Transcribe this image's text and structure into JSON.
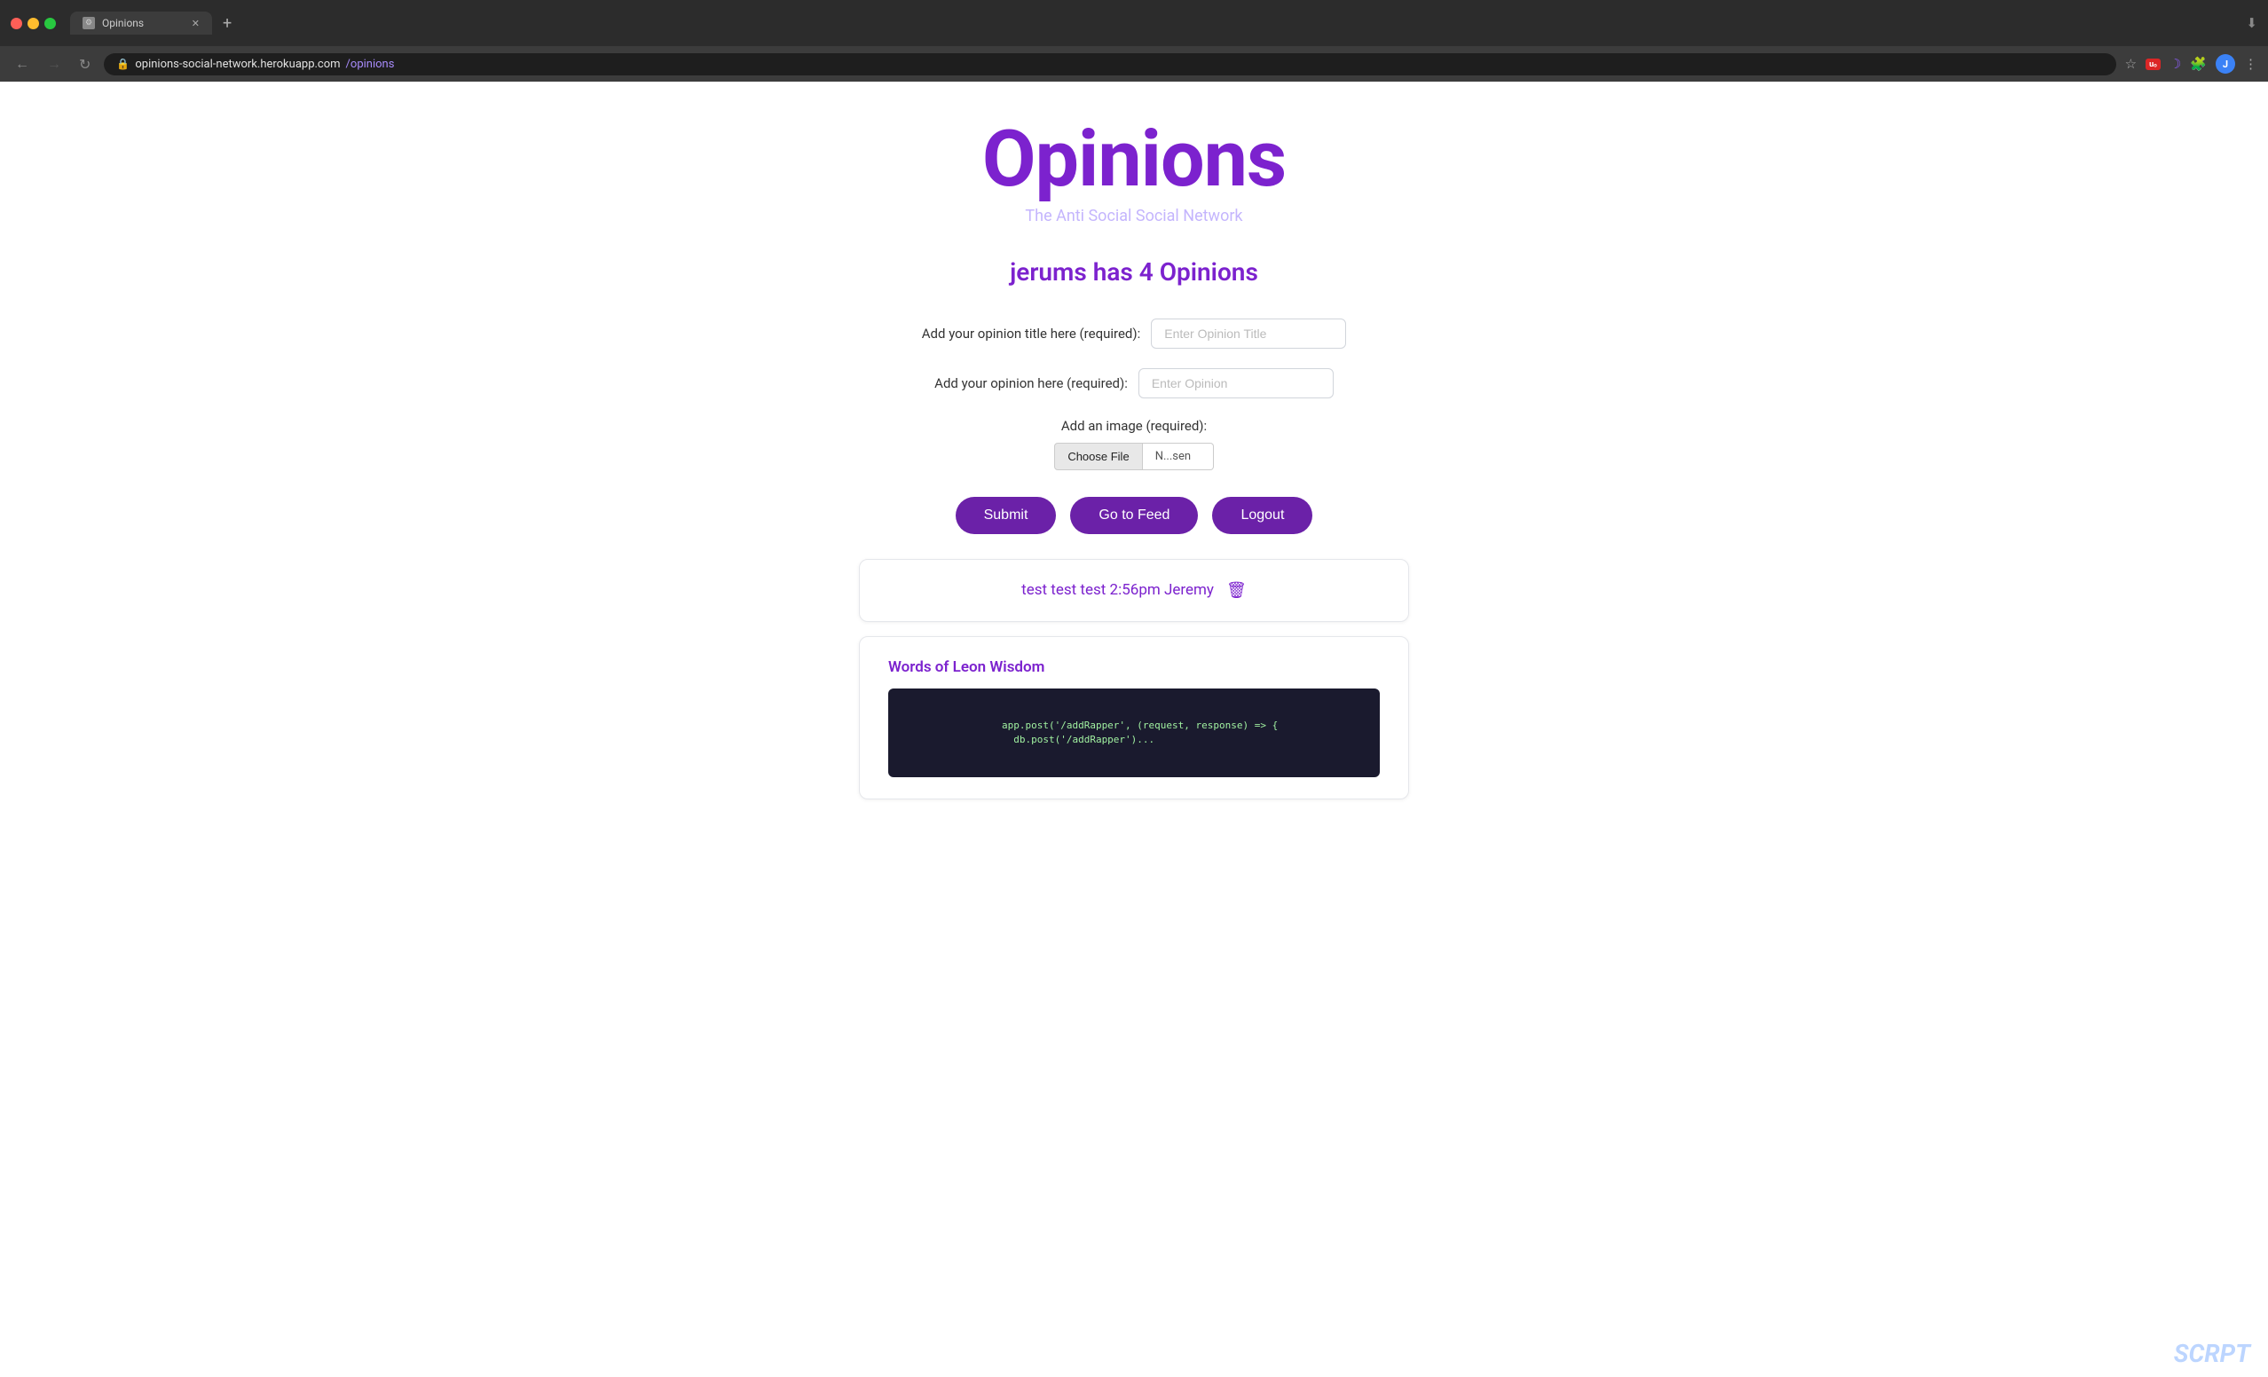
{
  "browser": {
    "tab_title": "Opinions",
    "url_base": "opinions-social-network.herokuapp.com",
    "url_path": "/opinions",
    "new_tab_icon": "+",
    "back_disabled": false,
    "forward_disabled": true
  },
  "header": {
    "title": "Opinions",
    "subtitle": "The Anti Social Social Network"
  },
  "user_section": {
    "count_label": "jerums has 4 Opinions"
  },
  "form": {
    "title_label": "Add your opinion title here (required):",
    "title_placeholder": "Enter Opinion Title",
    "opinion_label": "Add your opinion here (required):",
    "opinion_placeholder": "Enter Opinion",
    "image_label": "Add an image (required):",
    "choose_file_label": "Choose File",
    "file_name": "N...sen",
    "submit_label": "Submit",
    "feed_label": "Go to Feed",
    "logout_label": "Logout"
  },
  "cards": [
    {
      "id": 1,
      "text": "test test test 2:56pm Jeremy",
      "has_trash": true,
      "has_image": false,
      "title": null
    },
    {
      "id": 2,
      "text": null,
      "has_trash": false,
      "has_image": true,
      "title": "Words of Leon Wisdom",
      "code_snippet": "  app.post('/addRapper', (request, response) => {\n    db.post('/addRapper')..."
    }
  ],
  "colors": {
    "purple_dark": "#6b21a8",
    "purple_brand": "#7c22ce",
    "purple_light": "#c4b5fd"
  }
}
